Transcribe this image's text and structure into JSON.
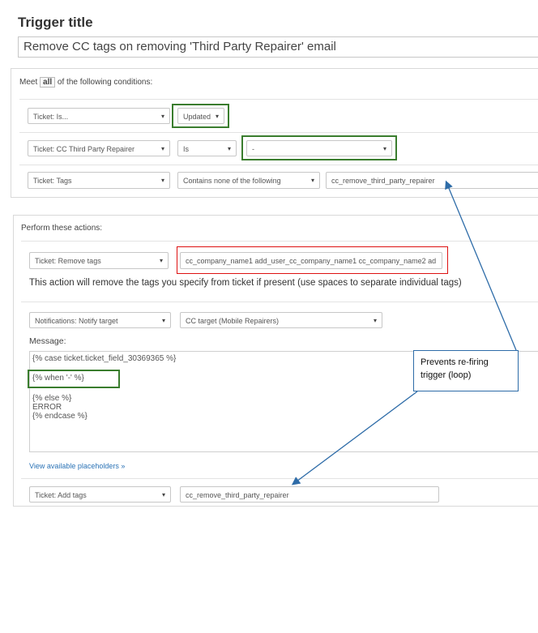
{
  "trigger": {
    "title_label": "Trigger title",
    "title_value": "Remove CC tags on removing 'Third Party Repairer' email"
  },
  "conditions": {
    "meet_prefix": "Meet",
    "meet_value": "all",
    "meet_suffix": "of the following conditions:",
    "rows": [
      {
        "field": "Ticket: Is...",
        "operator": "Updated"
      },
      {
        "field": "Ticket: CC Third Party Repairer",
        "operator": "Is",
        "value": "-"
      },
      {
        "field": "Ticket: Tags",
        "operator": "Contains none of the following",
        "value": "cc_remove_third_party_repairer"
      }
    ]
  },
  "actions": {
    "heading": "Perform these actions:",
    "remove_tags": {
      "field": "Ticket: Remove tags",
      "value": "cc_company_name1 add_user_cc_company_name1 cc_company_name2 ad",
      "help": "This action will remove the tags you specify from ticket if present (use spaces to separate individual tags)"
    },
    "notify": {
      "field": "Notifications: Notify target",
      "target": "CC target (Mobile Repairers)",
      "message_label": "Message:",
      "message_line1": "{% case ticket.ticket_field_30369365 %}",
      "message_line2": "{% when '-' %}",
      "message_line3": "{% else %}",
      "message_line4": "ERROR",
      "message_line5": "{% endcase %}",
      "placeholders_link": "View available placeholders »"
    },
    "add_tags": {
      "field": "Ticket: Add tags",
      "value": "cc_remove_third_party_repairer"
    }
  },
  "callout": {
    "text_line1": "Prevents re-firing",
    "text_line2": "trigger (loop)"
  },
  "icons": {
    "dropdown": "▾"
  },
  "colors": {
    "highlight_green": "#3a7d2e",
    "highlight_red": "#dd1111",
    "arrow_blue": "#2e6ca8",
    "link": "#2b73b6"
  }
}
